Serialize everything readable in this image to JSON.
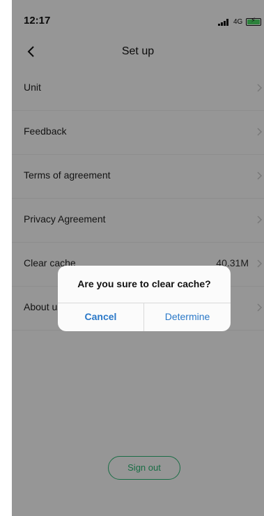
{
  "status_bar": {
    "time": "12:17",
    "network": "4G"
  },
  "nav": {
    "title": "Set up"
  },
  "settings": {
    "items": [
      {
        "label": "Unit",
        "value": ""
      },
      {
        "label": "Feedback",
        "value": ""
      },
      {
        "label": "Terms of agreement",
        "value": ""
      },
      {
        "label": "Privacy Agreement",
        "value": ""
      },
      {
        "label": "Clear cache",
        "value": "40.31M"
      },
      {
        "label": "About us",
        "value": ""
      }
    ]
  },
  "sign_out_label": "Sign out",
  "dialog": {
    "message": "Are you sure to clear cache?",
    "cancel_label": "Cancel",
    "confirm_label": "Determine"
  },
  "colors": {
    "accent_green": "#2bb673",
    "dialog_button_blue": "#2a78c8",
    "overlay": "rgba(0,0,0,0.40)"
  }
}
